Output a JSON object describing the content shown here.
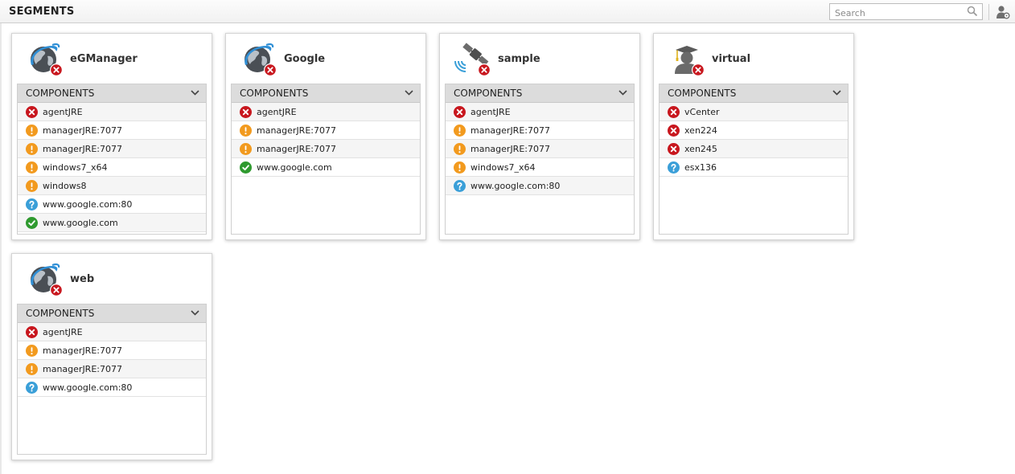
{
  "header": {
    "title": "SEGMENTS",
    "search_placeholder": "Search"
  },
  "colors": {
    "critical": "#c8171e",
    "major": "#f29a1e",
    "unknown": "#3a9fd8",
    "normal": "#2f9a2f"
  },
  "components_label": "COMPONENTS",
  "segments": [
    {
      "name": "eGManager",
      "icon": "globe-icon",
      "state": "critical",
      "components": [
        {
          "name": "agentJRE",
          "status": "critical"
        },
        {
          "name": "managerJRE:7077",
          "status": "major"
        },
        {
          "name": "managerJRE:7077",
          "status": "major"
        },
        {
          "name": "windows7_x64",
          "status": "major"
        },
        {
          "name": "windows8",
          "status": "major"
        },
        {
          "name": "www.google.com:80",
          "status": "unknown"
        },
        {
          "name": "www.google.com",
          "status": "normal"
        }
      ]
    },
    {
      "name": "Google",
      "icon": "globe-icon",
      "state": "critical",
      "components": [
        {
          "name": "agentJRE",
          "status": "critical"
        },
        {
          "name": "managerJRE:7077",
          "status": "major"
        },
        {
          "name": "managerJRE:7077",
          "status": "major"
        },
        {
          "name": "www.google.com",
          "status": "normal"
        }
      ]
    },
    {
      "name": "sample",
      "icon": "satellite-icon",
      "state": "critical",
      "components": [
        {
          "name": "agentJRE",
          "status": "critical"
        },
        {
          "name": "managerJRE:7077",
          "status": "major"
        },
        {
          "name": "managerJRE:7077",
          "status": "major"
        },
        {
          "name": "windows7_x64",
          "status": "major"
        },
        {
          "name": "www.google.com:80",
          "status": "unknown"
        }
      ]
    },
    {
      "name": "virtual",
      "icon": "graduate-icon",
      "state": "critical",
      "components": [
        {
          "name": "vCenter",
          "status": "critical"
        },
        {
          "name": "xen224",
          "status": "critical"
        },
        {
          "name": "xen245",
          "status": "critical"
        },
        {
          "name": "esx136",
          "status": "unknown"
        }
      ]
    },
    {
      "name": "web",
      "icon": "globe-icon",
      "state": "critical",
      "components": [
        {
          "name": "agentJRE",
          "status": "critical"
        },
        {
          "name": "managerJRE:7077",
          "status": "major"
        },
        {
          "name": "managerJRE:7077",
          "status": "major"
        },
        {
          "name": "www.google.com:80",
          "status": "unknown"
        }
      ]
    }
  ]
}
